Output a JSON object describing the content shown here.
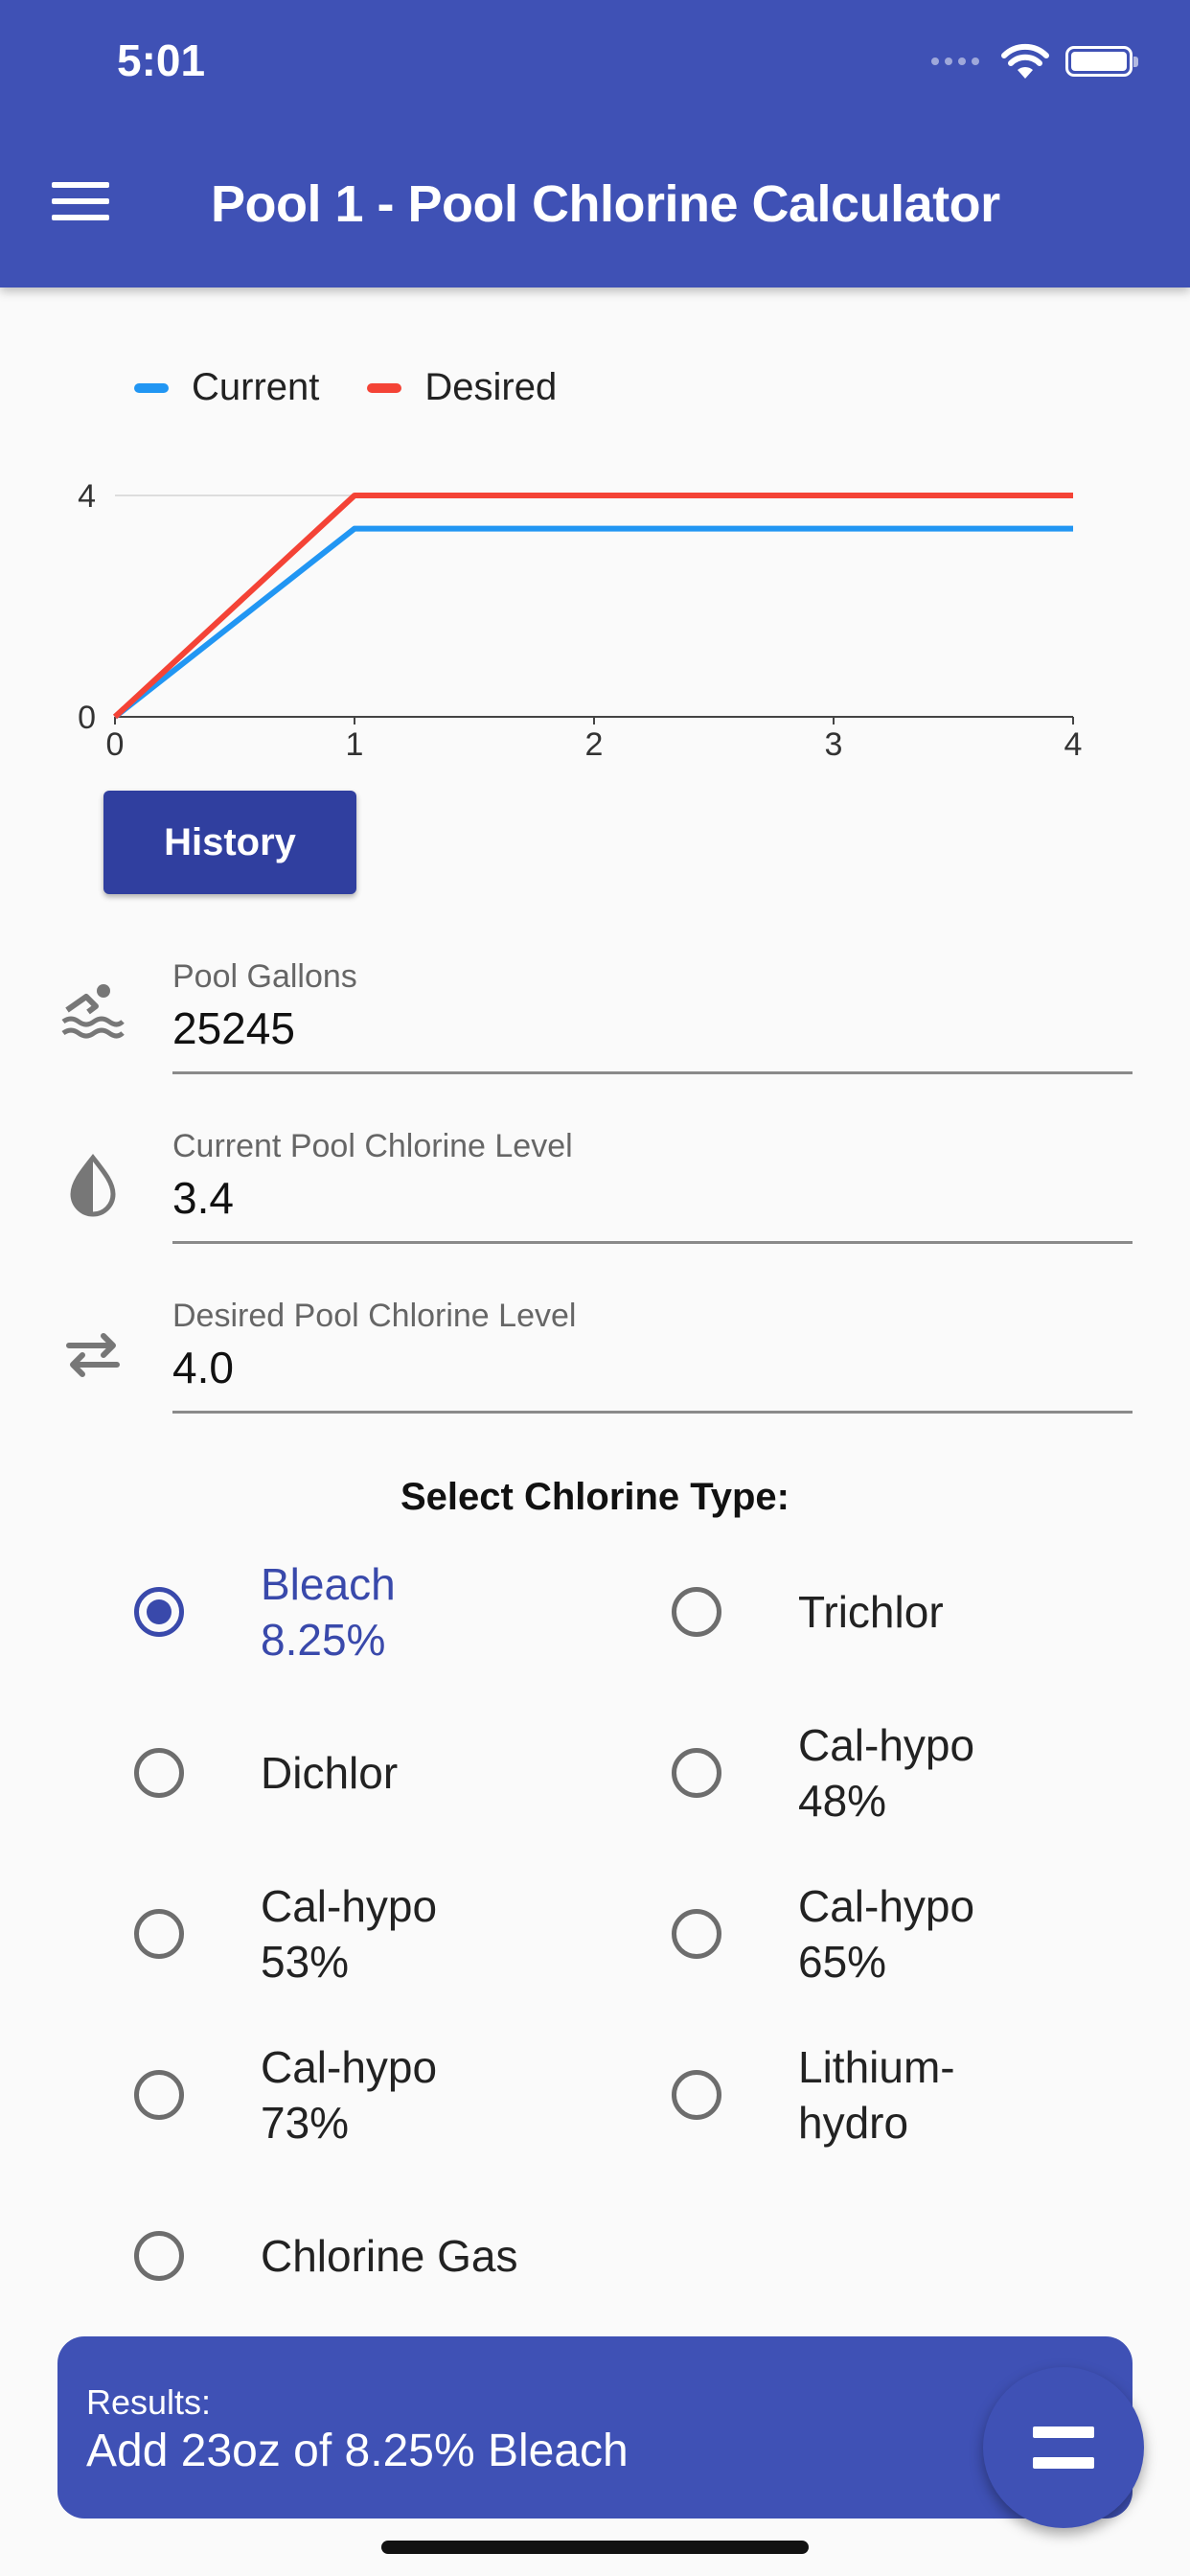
{
  "status_bar": {
    "time": "5:01",
    "wifi_icon": "wifi-icon",
    "battery_icon": "battery-icon"
  },
  "app_bar": {
    "title": "Pool 1 - Pool Chlorine Calculator",
    "menu_icon": "menu-icon"
  },
  "chart_data": {
    "type": "line",
    "x": [
      0,
      1,
      2,
      3,
      4
    ],
    "series": [
      {
        "name": "Current",
        "color": "#2196f3",
        "values": [
          0,
          3.4,
          3.4,
          3.4,
          3.4
        ]
      },
      {
        "name": "Desired",
        "color": "#f44336",
        "values": [
          0,
          4.0,
          4.0,
          4.0,
          4.0
        ]
      }
    ],
    "x_ticks": [
      "0",
      "1",
      "2",
      "3",
      "4"
    ],
    "y_ticks": [
      "0",
      "4"
    ],
    "xlim": [
      0,
      4
    ],
    "ylim": [
      0,
      4
    ],
    "legend": "top-left"
  },
  "history_button": "History",
  "fields": {
    "pool_gallons": {
      "label": "Pool Gallons",
      "value": "25245"
    },
    "current_level": {
      "label": "Current Pool Chlorine Level",
      "value": "3.4"
    },
    "desired_level": {
      "label": "Desired Pool Chlorine Level",
      "value": "4.0"
    }
  },
  "chlorine_type": {
    "title": "Select Chlorine Type:",
    "options": [
      {
        "line1": "Bleach",
        "line2": "8.25%",
        "selected": true
      },
      {
        "line1": "Trichlor",
        "line2": ""
      },
      {
        "line1": "Dichlor",
        "line2": ""
      },
      {
        "line1": "Cal-hypo",
        "line2": "48%"
      },
      {
        "line1": "Cal-hypo",
        "line2": "53%"
      },
      {
        "line1": "Cal-hypo",
        "line2": "65%"
      },
      {
        "line1": "Cal-hypo",
        "line2": "73%"
      },
      {
        "line1": "Lithium-",
        "line2": "hydro"
      },
      {
        "line1": "Chlorine Gas",
        "line2": ""
      }
    ]
  },
  "results": {
    "label": "Results:",
    "text": "Add 23oz of 8.25% Bleach"
  },
  "colors": {
    "primary": "#3f51b5",
    "button": "#303f9f",
    "selected_radio": "#3949ab",
    "current": "#2196f3",
    "desired": "#f44336"
  }
}
